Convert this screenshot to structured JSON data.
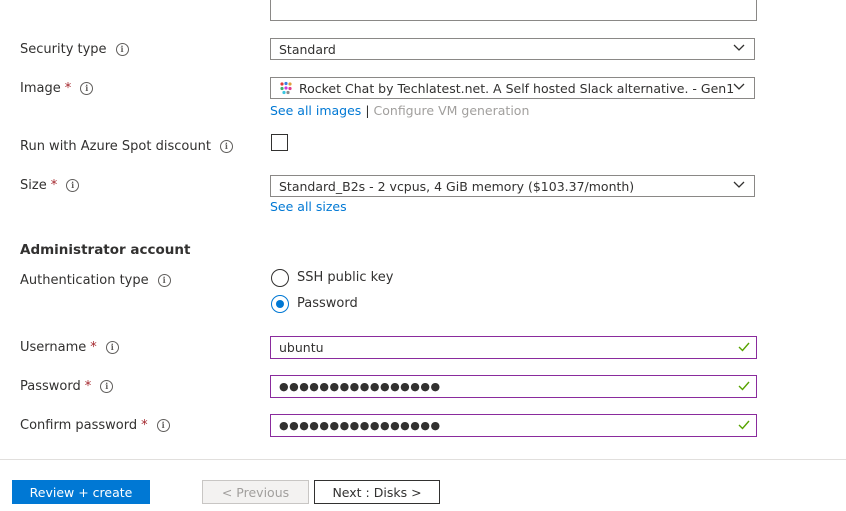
{
  "security_type": {
    "label": "Security type",
    "value": "Standard"
  },
  "image": {
    "label": "Image",
    "required": "*",
    "value": "Rocket Chat by Techlatest.net. A Self hosted Slack alternative. - Gen1",
    "icon": "rocket-chat-logo",
    "see_all_link": "See all images",
    "separator": "|",
    "configure_link": "Configure VM generation"
  },
  "spot": {
    "label": "Run with Azure Spot discount",
    "checked": false
  },
  "size": {
    "label": "Size",
    "required": "*",
    "value": "Standard_B2s - 2 vcpus, 4 GiB memory ($103.37/month)",
    "see_all_link": "See all sizes"
  },
  "admin_section": {
    "title": "Administrator account"
  },
  "auth_type": {
    "label": "Authentication type",
    "options": [
      "SSH public key",
      "Password"
    ],
    "selected": "Password"
  },
  "username": {
    "label": "Username",
    "required": "*",
    "value": "ubuntu"
  },
  "password": {
    "label": "Password",
    "required": "*",
    "value": "●●●●●●●●●●●●●●●●"
  },
  "confirm_password": {
    "label": "Confirm password",
    "required": "*",
    "value": "●●●●●●●●●●●●●●●●"
  },
  "footer": {
    "review_create": "Review + create",
    "previous": "< Previous",
    "next": "Next : Disks >"
  },
  "colors": {
    "accent": "#0078d4",
    "valid_border": "#8a2b9d",
    "valid_check": "#57a300",
    "required": "#a4262c"
  }
}
